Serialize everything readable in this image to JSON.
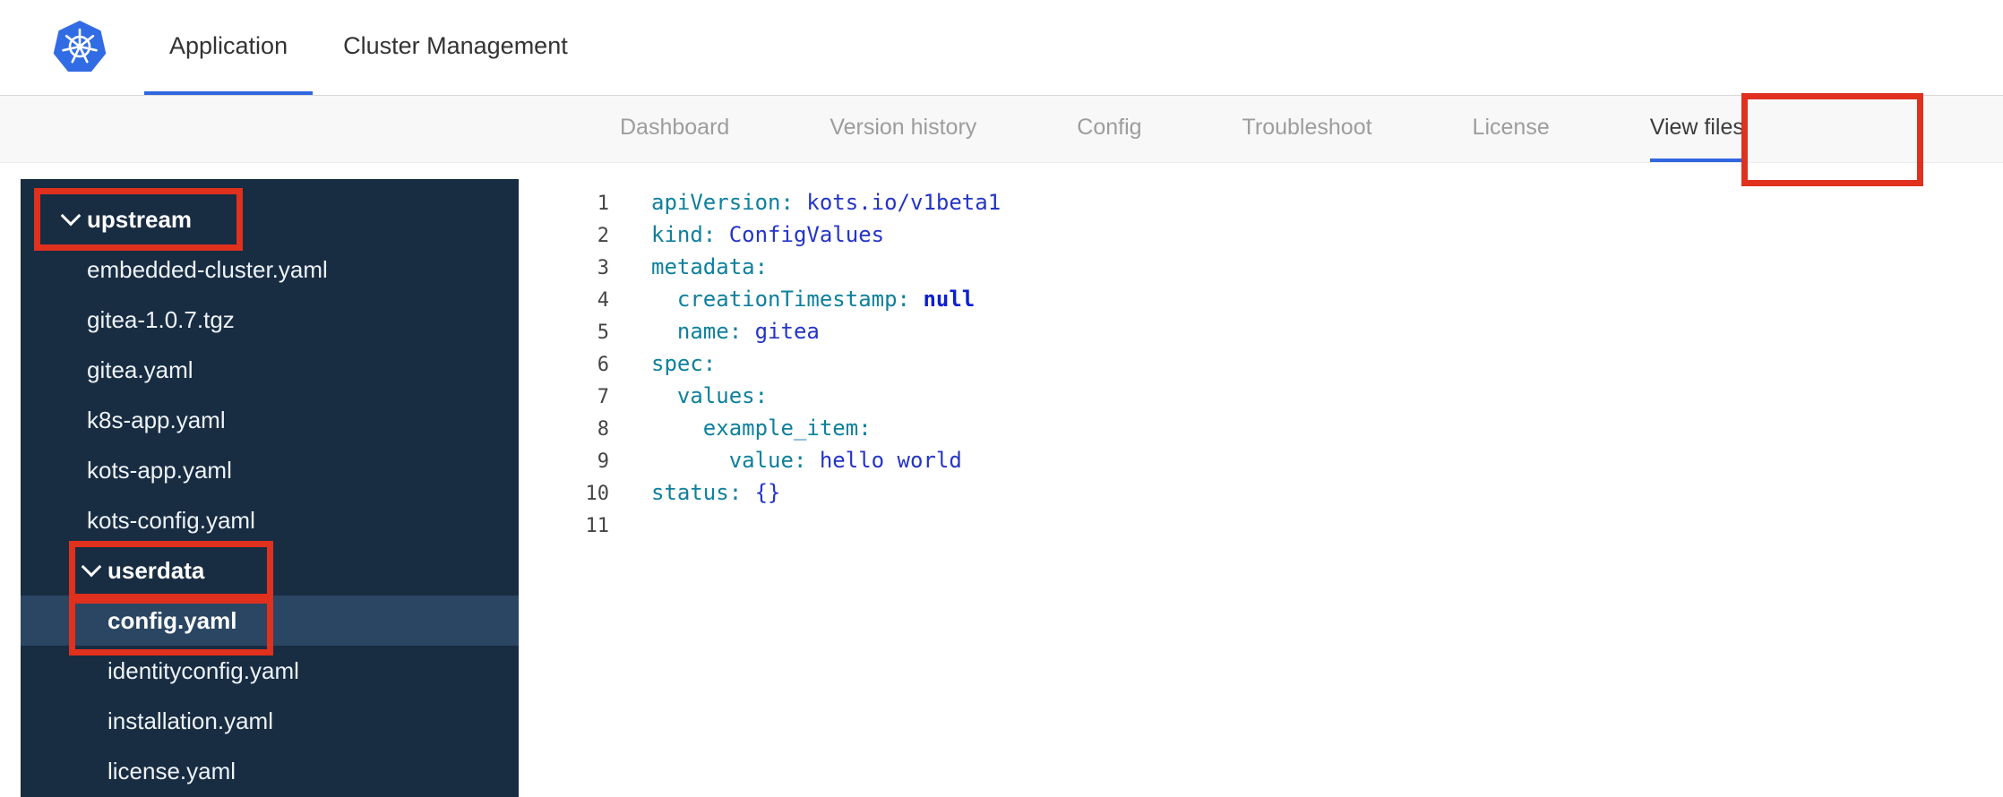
{
  "header": {
    "tabs": [
      {
        "label": "Application",
        "active": true
      },
      {
        "label": "Cluster Management",
        "active": false
      }
    ]
  },
  "subnav": {
    "items": [
      {
        "label": "Dashboard",
        "active": false
      },
      {
        "label": "Version history",
        "active": false
      },
      {
        "label": "Config",
        "active": false
      },
      {
        "label": "Troubleshoot",
        "active": false
      },
      {
        "label": "License",
        "active": false
      },
      {
        "label": "View files",
        "active": true
      }
    ]
  },
  "file_tree": {
    "items": [
      {
        "type": "folder",
        "label": "upstream",
        "level": 0,
        "expanded": true,
        "annotated": true
      },
      {
        "type": "file",
        "label": "embedded-cluster.yaml",
        "level": 0
      },
      {
        "type": "file",
        "label": "gitea-1.0.7.tgz",
        "level": 0
      },
      {
        "type": "file",
        "label": "gitea.yaml",
        "level": 0
      },
      {
        "type": "file",
        "label": "k8s-app.yaml",
        "level": 0
      },
      {
        "type": "file",
        "label": "kots-app.yaml",
        "level": 0
      },
      {
        "type": "file",
        "label": "kots-config.yaml",
        "level": 0
      },
      {
        "type": "folder",
        "label": "userdata",
        "level": 1,
        "expanded": true,
        "annotated": true
      },
      {
        "type": "file",
        "label": "config.yaml",
        "level": 1,
        "selected": true,
        "annotated": true
      },
      {
        "type": "file",
        "label": "identityconfig.yaml",
        "level": 1
      },
      {
        "type": "file",
        "label": "installation.yaml",
        "level": 1
      },
      {
        "type": "file",
        "label": "license.yaml",
        "level": 1
      }
    ]
  },
  "editor": {
    "file": "config.yaml",
    "lines": [
      {
        "num": 1,
        "tokens": [
          {
            "t": "apiVersion:",
            "c": "key"
          },
          {
            "t": " ",
            "c": "plain"
          },
          {
            "t": "kots.io/v1beta1",
            "c": "value"
          }
        ]
      },
      {
        "num": 2,
        "tokens": [
          {
            "t": "kind:",
            "c": "key"
          },
          {
            "t": " ",
            "c": "plain"
          },
          {
            "t": "ConfigValues",
            "c": "value"
          }
        ]
      },
      {
        "num": 3,
        "tokens": [
          {
            "t": "metadata:",
            "c": "key"
          }
        ]
      },
      {
        "num": 4,
        "tokens": [
          {
            "t": "  ",
            "c": "plain"
          },
          {
            "t": "creationTimestamp:",
            "c": "key"
          },
          {
            "t": " ",
            "c": "plain"
          },
          {
            "t": "null",
            "c": "keyword"
          }
        ]
      },
      {
        "num": 5,
        "tokens": [
          {
            "t": "  ",
            "c": "plain"
          },
          {
            "t": "name:",
            "c": "key"
          },
          {
            "t": " ",
            "c": "plain"
          },
          {
            "t": "gitea",
            "c": "value"
          }
        ]
      },
      {
        "num": 6,
        "tokens": [
          {
            "t": "spec:",
            "c": "key"
          }
        ]
      },
      {
        "num": 7,
        "tokens": [
          {
            "t": "  ",
            "c": "plain"
          },
          {
            "t": "values:",
            "c": "key"
          }
        ]
      },
      {
        "num": 8,
        "tokens": [
          {
            "t": "    ",
            "c": "plain"
          },
          {
            "t": "example_item:",
            "c": "key"
          }
        ]
      },
      {
        "num": 9,
        "tokens": [
          {
            "t": "      ",
            "c": "plain"
          },
          {
            "t": "value:",
            "c": "key"
          },
          {
            "t": " ",
            "c": "plain"
          },
          {
            "t": "hello world",
            "c": "value"
          }
        ]
      },
      {
        "num": 10,
        "tokens": [
          {
            "t": "status:",
            "c": "key"
          },
          {
            "t": " ",
            "c": "plain"
          },
          {
            "t": "{}",
            "c": "value"
          }
        ]
      },
      {
        "num": 11,
        "tokens": []
      }
    ]
  },
  "icons": {
    "logo": "kubernetes-logo",
    "tree_chevron": "chevron-down-icon"
  },
  "colors": {
    "accent": "#3066e0",
    "annotation_red": "#e0301e",
    "sidebar_bg": "#182c42",
    "sidebar_selected": "#2a4663",
    "logo_blue": "#326ce5",
    "syntax": {
      "key": "#0f809c",
      "value": "#2434c7",
      "keyword": "#0b1ed2"
    }
  }
}
